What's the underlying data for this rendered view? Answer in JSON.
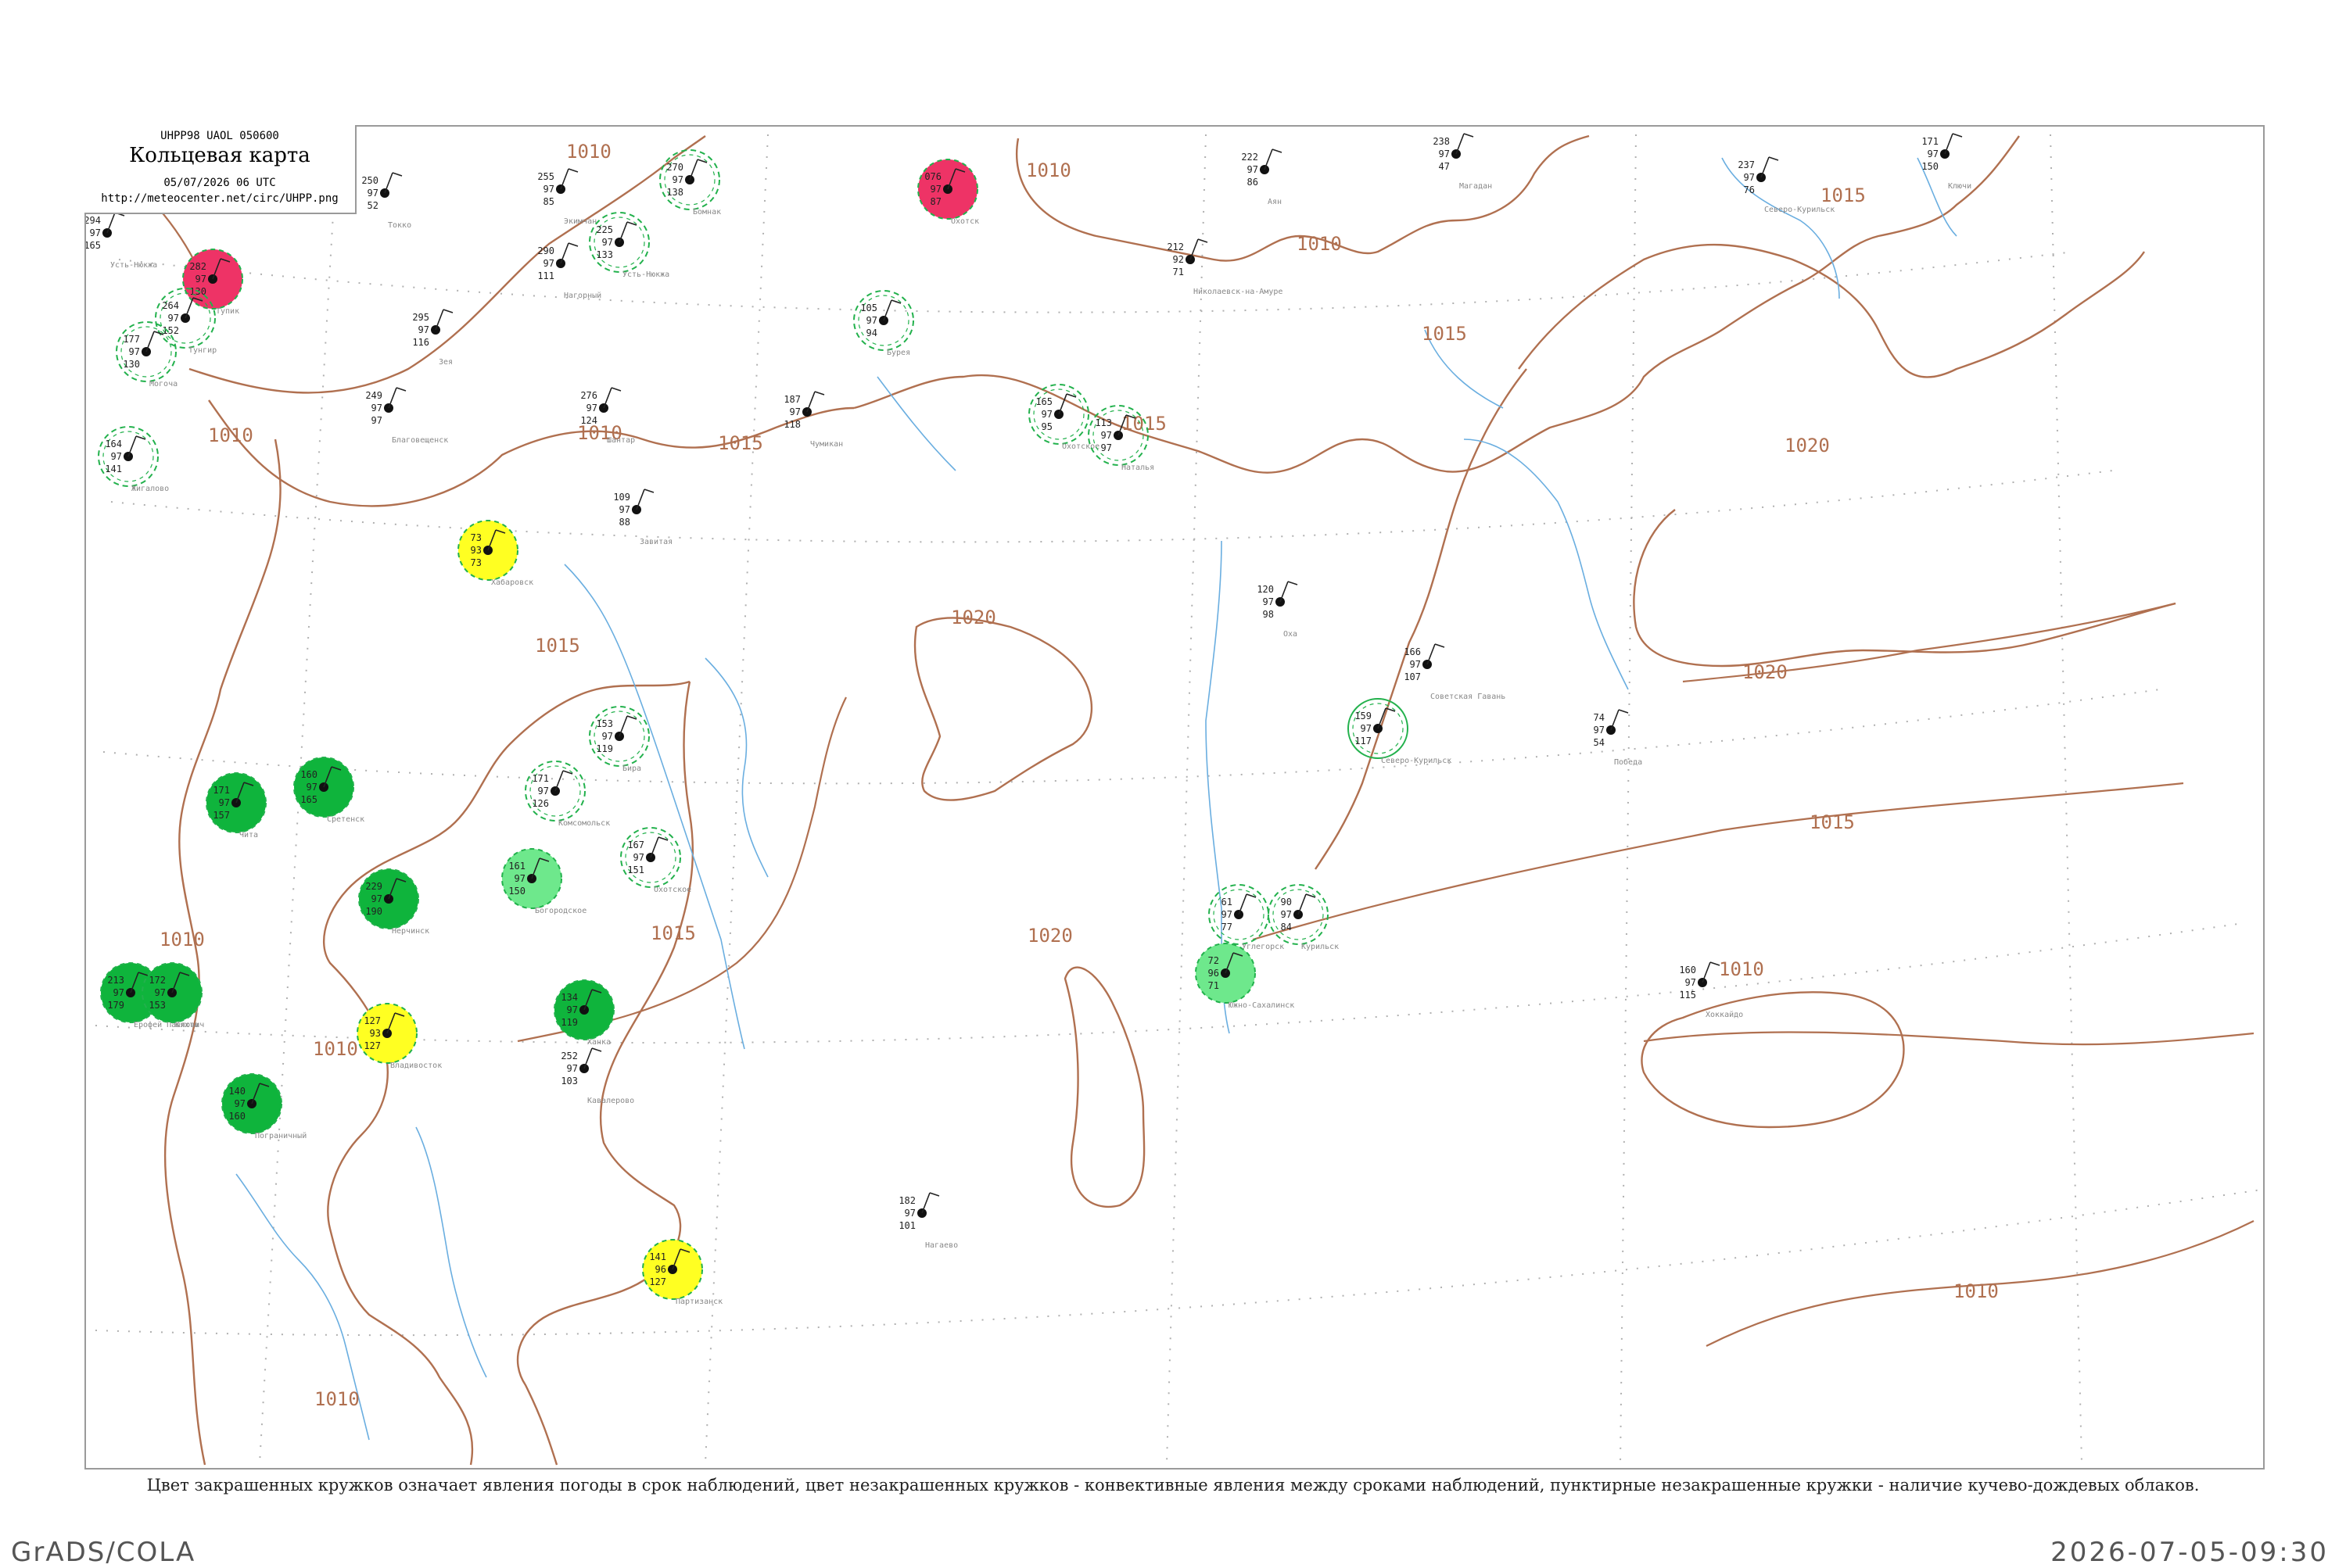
{
  "header": {
    "product_code": "UHPP98  UAOL  050600",
    "title": "Кольцевая карта",
    "datetime": "05/07/2026 06 UTC",
    "url": "http://meteocenter.net/circ/UHPP.png"
  },
  "caption": "Цвет закрашенных кружков означает явления погоды в срок наблюдений, цвет незакрашенных кружков - конвективные явления между сроками наблюдений, пунктирные незакрашенные кружки - наличие кучево-дождевых облаков.",
  "footer": {
    "left": "GrADS/COLA",
    "right": "2026-07-05-09:30"
  },
  "colors": {
    "isobar": "#b07050",
    "coast": "#b07050",
    "rivers": "#6aaee0",
    "grid": "#b0b0b0",
    "frame": "#9a9a9a",
    "ring_green": "#22b14c",
    "fill_green": "#0fb43c",
    "fill_light_green": "#6ee88c",
    "fill_yellow": "#ffff22",
    "fill_red": "#ee3366"
  },
  "isobars": [
    {
      "label": "1010"
    },
    {
      "label": "1015"
    },
    {
      "label": "1020"
    }
  ],
  "stations": [
    {
      "name": "Усть-Нюкжа",
      "t": "294",
      "n": "97",
      "p": "165",
      "style": "none"
    },
    {
      "name": "Тупик",
      "t": "282",
      "n": "97",
      "p": "130",
      "style": "red"
    },
    {
      "name": "Токко",
      "t": "250",
      "n": "97",
      "p": "52",
      "style": "none"
    },
    {
      "name": "Тунгир",
      "t": "264",
      "n": "97",
      "p": "152",
      "style": "ring-dash"
    },
    {
      "name": "Могоча",
      "t": "177",
      "n": "97",
      "p": "130",
      "style": "ring-dash"
    },
    {
      "name": "Экимчан",
      "t": "255",
      "n": "97",
      "p": "85",
      "style": "none"
    },
    {
      "name": "Бомнак",
      "t": "270",
      "n": "97",
      "p": "138",
      "style": "ring-dash"
    },
    {
      "name": "Охотск",
      "t": "076",
      "n": "97",
      "p": "87",
      "style": "red"
    },
    {
      "name": "Нагорный",
      "t": "290",
      "n": "97",
      "p": "111",
      "style": "none"
    },
    {
      "name": "Усть-Нюкжа",
      "t": "225",
      "n": "97",
      "p": "133",
      "style": "ring-dash"
    },
    {
      "name": "Зея",
      "t": "295",
      "n": "97",
      "p": "116",
      "style": "none"
    },
    {
      "name": "Аян",
      "t": "222",
      "n": "97",
      "p": "86",
      "style": "none"
    },
    {
      "name": "Магадан",
      "t": "238",
      "n": "97",
      "p": "47",
      "style": "none"
    },
    {
      "name": "Северо-Курильск",
      "t": "237",
      "n": "97",
      "p": "76",
      "style": "none"
    },
    {
      "name": "Ключи",
      "t": "171",
      "n": "97",
      "p": "150",
      "style": "none"
    },
    {
      "name": "Бурея",
      "t": "105",
      "n": "97",
      "p": "94",
      "style": "ring-dash"
    },
    {
      "name": "Николаевск-на-Амуре",
      "t": "212",
      "n": "92",
      "p": "71",
      "style": "none"
    },
    {
      "name": "Шантар",
      "t": "276",
      "n": "97",
      "p": "124",
      "style": "none"
    },
    {
      "name": "Благовещенск",
      "t": "249",
      "n": "97",
      "p": "97",
      "style": "none"
    },
    {
      "name": "Чумикан",
      "t": "187",
      "n": "97",
      "p": "118",
      "style": "none"
    },
    {
      "name": "Охотское",
      "t": "165",
      "n": "97",
      "p": "95",
      "style": "ring-dash"
    },
    {
      "name": "Наталья",
      "t": "113",
      "n": "97",
      "p": "97",
      "style": "ring-dash"
    },
    {
      "name": "Жигалово",
      "t": "164",
      "n": "97",
      "p": "141",
      "style": "ring-dash"
    },
    {
      "name": "Завитая",
      "t": "109",
      "n": "97",
      "p": "88",
      "style": "none"
    },
    {
      "name": "Хабаровск",
      "t": "73",
      "n": "93",
      "p": "73",
      "style": "yellow"
    },
    {
      "name": "Владивосток",
      "t": "127",
      "n": "93",
      "p": "127",
      "style": "yellow"
    },
    {
      "name": "Партизанск",
      "t": "141",
      "n": "96",
      "p": "127",
      "style": "yellow"
    },
    {
      "name": "Богородское",
      "t": "161",
      "n": "97",
      "p": "150",
      "style": "light-green"
    },
    {
      "name": "Комсомольск",
      "t": "171",
      "n": "97",
      "p": "126",
      "style": "ring-dash"
    },
    {
      "name": "Южно-Сахалинск",
      "t": "72",
      "n": "96",
      "p": "71",
      "style": "light-green"
    },
    {
      "name": "Углегорск",
      "t": "61",
      "n": "97",
      "p": "77",
      "style": "ring-dash"
    },
    {
      "name": "Курильск",
      "t": "90",
      "n": "97",
      "p": "84",
      "style": "ring-dash"
    },
    {
      "name": "Северо-Курильск",
      "t": "159",
      "n": "97",
      "p": "117",
      "style": "ring-solid"
    },
    {
      "name": "Оха",
      "t": "120",
      "n": "97",
      "p": "98",
      "style": "none"
    },
    {
      "name": "Охотское",
      "t": "167",
      "n": "97",
      "p": "151",
      "style": "ring-dash"
    },
    {
      "name": "Бира",
      "t": "153",
      "n": "97",
      "p": "119",
      "style": "ring-dash"
    },
    {
      "name": "Чита",
      "t": "171",
      "n": "97",
      "p": "157",
      "style": "green"
    },
    {
      "name": "Сретенск",
      "t": "160",
      "n": "97",
      "p": "165",
      "style": "green"
    },
    {
      "name": "Нерчинск",
      "t": "229",
      "n": "97",
      "p": "190",
      "style": "green"
    },
    {
      "name": "Ерофей Павлович",
      "t": "213",
      "n": "97",
      "p": "179",
      "style": "green"
    },
    {
      "name": "Кяхта",
      "t": "172",
      "n": "97",
      "p": "153",
      "style": "green"
    },
    {
      "name": "Пограничный",
      "t": "140",
      "n": "97",
      "p": "160",
      "style": "green"
    },
    {
      "name": "Ханка",
      "t": "134",
      "n": "97",
      "p": "119",
      "style": "green"
    },
    {
      "name": "Кавалерово",
      "t": "252",
      "n": "97",
      "p": "103",
      "style": "none"
    },
    {
      "name": "Победа",
      "t": "74",
      "n": "97",
      "p": "54",
      "style": "none"
    },
    {
      "name": "Советская Гавань",
      "t": "166",
      "n": "97",
      "p": "107",
      "style": "none"
    },
    {
      "name": "Хоккайдо",
      "t": "160",
      "n": "97",
      "p": "115",
      "style": "none"
    },
    {
      "name": "Нагаево",
      "t": "182",
      "n": "97",
      "p": "101",
      "style": "none"
    }
  ]
}
